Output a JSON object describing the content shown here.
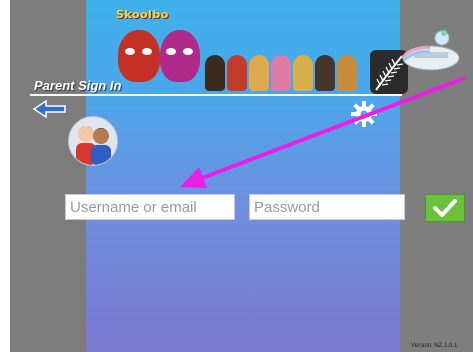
{
  "header": {
    "logo_text": "Skoolbo",
    "title": "Parent Sign In"
  },
  "form": {
    "username_placeholder": "Username or email",
    "password_placeholder": "Password"
  },
  "footer": {
    "version": "Version: NZ 1.0.1"
  },
  "colors": {
    "side_panel": "#7c7c7c",
    "background_top": "#3fb0ea",
    "background_bottom": "#7a78d0",
    "submit_button": "#6ac13b",
    "back_arrow": "#2f6fd2",
    "annotation_arrow": "#ea1ee6"
  },
  "icons": {
    "back": "left-arrow-icon",
    "settings": "gear-icon",
    "submit": "checkmark-icon",
    "parents": "parents-avatar-icon"
  }
}
